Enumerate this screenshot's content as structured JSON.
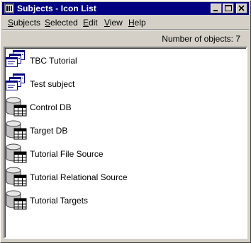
{
  "window": {
    "title": "Subjects - Icon List"
  },
  "menu": {
    "items": [
      {
        "label": "Subjects",
        "accel": "S",
        "rest": "ubjects"
      },
      {
        "label": "Selected",
        "accel": "S",
        "rest": "elected"
      },
      {
        "label": "Edit",
        "accel": "E",
        "rest": "dit"
      },
      {
        "label": "View",
        "accel": "V",
        "rest": "iew"
      },
      {
        "label": "Help",
        "accel": "H",
        "rest": "elp"
      }
    ]
  },
  "status": {
    "object_count_text": "Number of objects: 7"
  },
  "list": {
    "items": [
      {
        "label": "TBC Tutorial",
        "icon": "subject-icon"
      },
      {
        "label": "Test subject",
        "icon": "subject-icon"
      },
      {
        "label": "Control DB",
        "icon": "database-icon"
      },
      {
        "label": "Target DB",
        "icon": "database-icon"
      },
      {
        "label": "Tutorial File Source",
        "icon": "database-icon"
      },
      {
        "label": "Tutorial Relational Source",
        "icon": "database-icon"
      },
      {
        "label": "Tutorial Targets",
        "icon": "database-icon"
      }
    ]
  },
  "colors": {
    "titlebar": "#000080",
    "face": "#d4d0c8",
    "list_bg": "#ffffff"
  }
}
